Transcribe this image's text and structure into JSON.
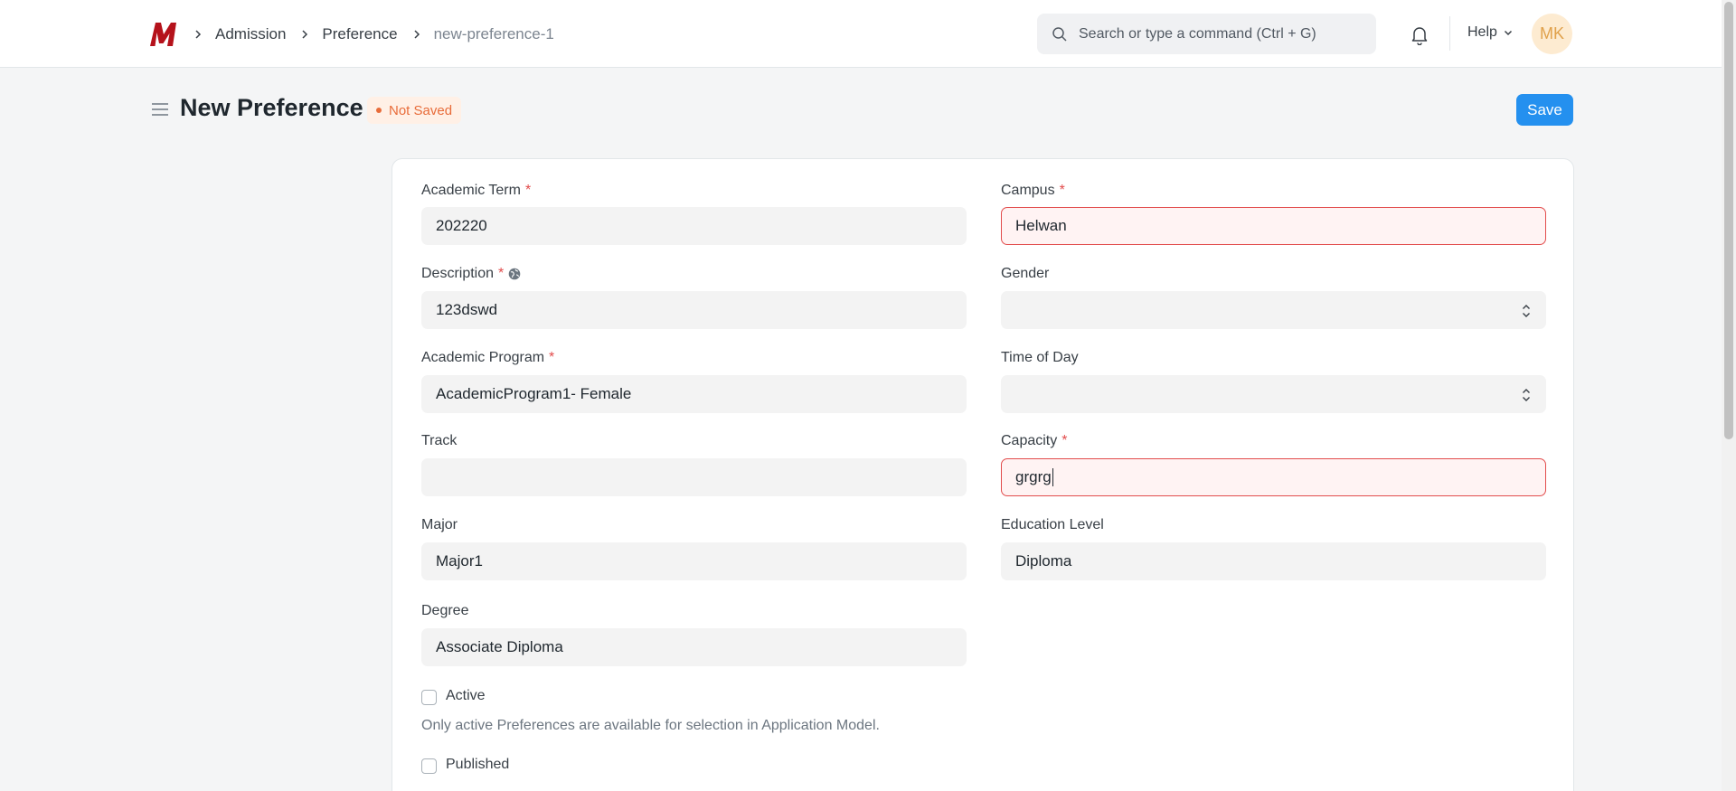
{
  "navbar": {
    "logo_letter": "M",
    "breadcrumbs": [
      "Admission",
      "Preference",
      "new-preference-1"
    ],
    "search_placeholder": "Search or type a command (Ctrl + G)",
    "help_label": "Help",
    "avatar_initials": "MK"
  },
  "page": {
    "title": "New Preference",
    "status": "Not Saved",
    "save_label": "Save"
  },
  "form": {
    "academic_term": {
      "label": "Academic Term",
      "required": "*",
      "value": "202220"
    },
    "campus": {
      "label": "Campus",
      "required": "*",
      "value": "Helwan"
    },
    "description": {
      "label": "Description",
      "required": "*",
      "value": "123dswd"
    },
    "gender": {
      "label": "Gender",
      "value": ""
    },
    "academic_program": {
      "label": "Academic Program",
      "required": "*",
      "value": "AcademicProgram1- Female"
    },
    "time_of_day": {
      "label": "Time of Day",
      "value": ""
    },
    "track": {
      "label": "Track",
      "value": ""
    },
    "capacity": {
      "label": "Capacity",
      "required": "*",
      "value": "grgrg"
    },
    "major": {
      "label": "Major",
      "value": "Major1"
    },
    "education_level": {
      "label": "Education Level",
      "value": "Diploma"
    },
    "degree": {
      "label": "Degree",
      "value": "Associate Diploma"
    },
    "active": {
      "label": "Active",
      "checked": false,
      "help": "Only active Preferences are available for selection in Application Model."
    },
    "published": {
      "label": "Published",
      "checked": false
    }
  },
  "colors": {
    "primary": "#2490ef",
    "error": "#e24c4c",
    "not_saved": "#e86c3a",
    "logo": "#b5121b"
  }
}
